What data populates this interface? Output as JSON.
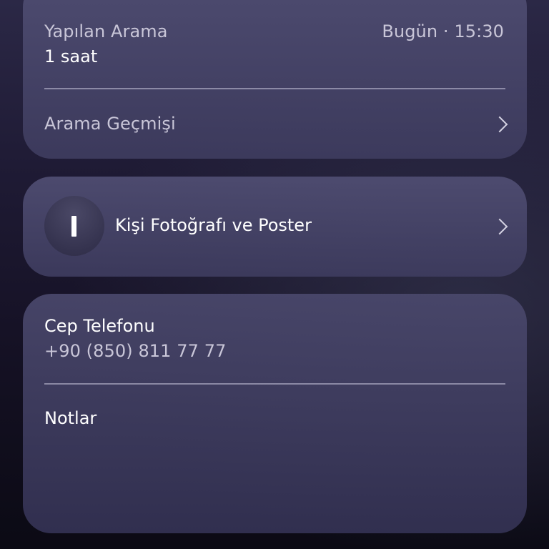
{
  "call_card": {
    "call_type": "Yapılan Arama",
    "duration": "1 saat",
    "timestamp": "Bugün · 15:30",
    "history_label": "Arama Geçmişi"
  },
  "poster_card": {
    "label": "Kişi Fotoğrafı ve Poster"
  },
  "contact_card": {
    "phone_label": "Cep Telefonu",
    "phone_number": "+90 (850) 811 77 77",
    "notes_label": "Notlar"
  },
  "icons": {
    "chevron": "chevron-right-icon",
    "avatar": "avatar-icon"
  },
  "colors": {
    "card_bg": "#4f4e73",
    "muted_text": "#c9c6d8",
    "divider": "#c8c6dc"
  }
}
